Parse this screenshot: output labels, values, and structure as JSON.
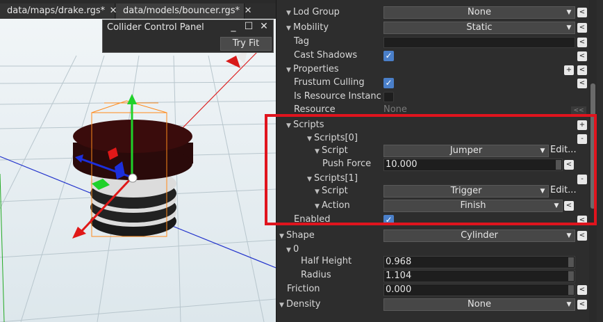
{
  "tabs": [
    {
      "label": "data/maps/drake.rgs*",
      "close": "✕"
    },
    {
      "label": "data/models/bouncer.rgs*",
      "close": "✕"
    }
  ],
  "collider_panel": {
    "title": "Collider Control Panel",
    "minimize": "_",
    "maximize": "☐",
    "close": "✕",
    "try_fit": "Try Fit"
  },
  "inspector": {
    "lod_group": {
      "label": "Lod Group",
      "value": "None"
    },
    "mobility": {
      "label": "Mobility",
      "value": "Static"
    },
    "tag": {
      "label": "Tag",
      "value": ""
    },
    "cast_shadows": {
      "label": "Cast Shadows",
      "checked": true
    },
    "properties": {
      "label": "Properties"
    },
    "frustum_culling": {
      "label": "Frustum Culling",
      "checked": true
    },
    "is_resource_instance": {
      "label": "Is Resource Instanc",
      "checked": false
    },
    "resource": {
      "label": "Resource",
      "value": "None",
      "button": "<<"
    },
    "scripts": {
      "label": "Scripts"
    },
    "scripts0": {
      "label": "Scripts[0]"
    },
    "script0": {
      "label": "Script",
      "value": "Jumper",
      "edit": "Edit..."
    },
    "push_force": {
      "label": "Push Force",
      "value": "10.000"
    },
    "scripts1": {
      "label": "Scripts[1]"
    },
    "script1": {
      "label": "Script",
      "value": "Trigger",
      "edit": "Edit..."
    },
    "action": {
      "label": "Action",
      "value": "Finish"
    },
    "enabled": {
      "label": "Enabled",
      "checked": true
    },
    "shape": {
      "label": "Shape",
      "value": "Cylinder"
    },
    "shape0": {
      "label": "0"
    },
    "half_height": {
      "label": "Half Height",
      "value": "0.968"
    },
    "radius": {
      "label": "Radius",
      "value": "1.104"
    },
    "friction": {
      "label": "Friction",
      "value": "0.000"
    },
    "density": {
      "label": "Density",
      "value": "None"
    }
  },
  "glyphs": {
    "reset": "<",
    "add": "+",
    "remove": "-",
    "collapse": "▼",
    "dropdown": "▼"
  },
  "colors": {
    "highlight": "#e0141e",
    "check": "#4a7fc9",
    "background": "#2d2d2d"
  }
}
